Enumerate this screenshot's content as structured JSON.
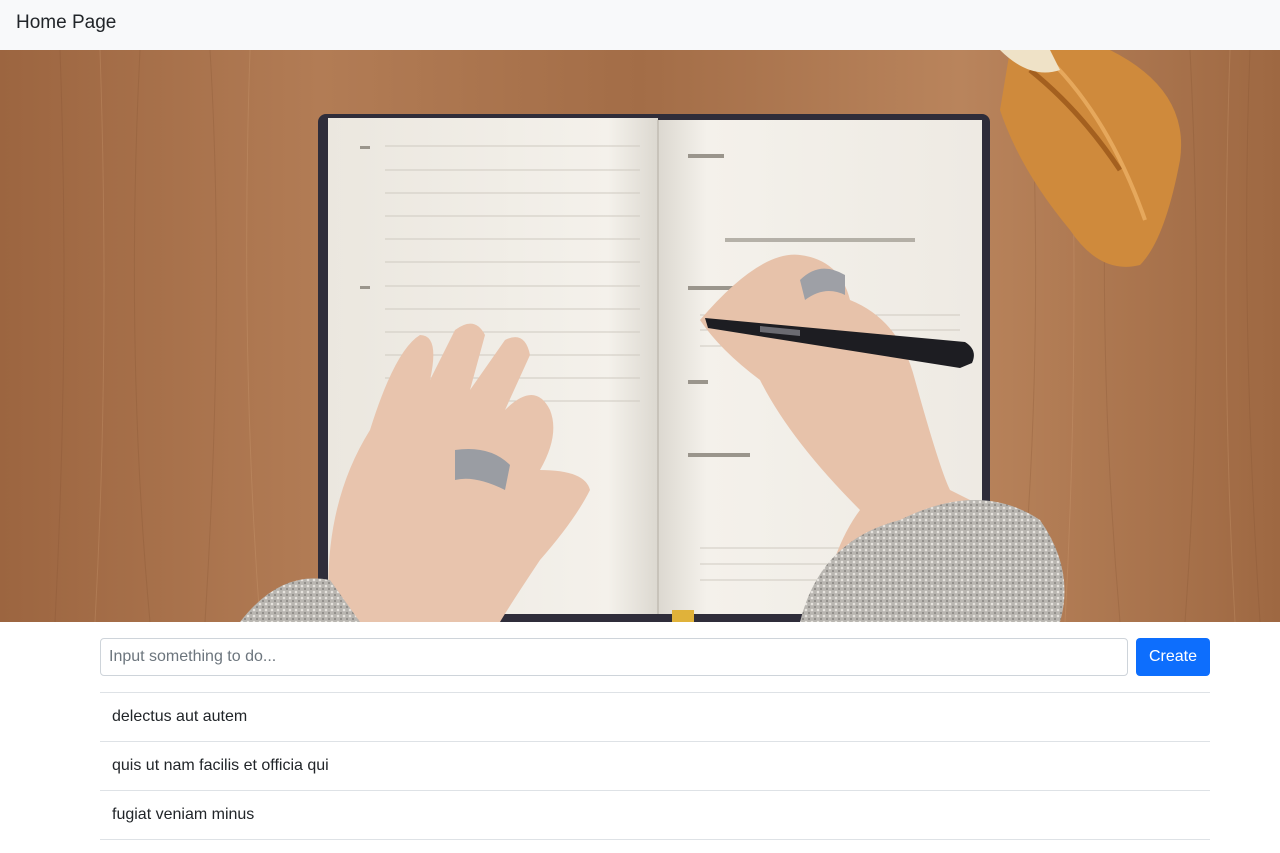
{
  "navbar": {
    "brand": "Home Page"
  },
  "hero": {
    "image": "notebook-writing-photo",
    "colors": {
      "wood": "#a8724a",
      "paper": "#f3f0ea",
      "cover": "#2f2d3a",
      "pastry": "#d08a3a"
    }
  },
  "form": {
    "placeholder": "Input something to do...",
    "value": "",
    "button_label": "Create"
  },
  "todos": [
    {
      "text": "delectus aut autem"
    },
    {
      "text": "quis ut nam facilis et officia qui"
    },
    {
      "text": "fugiat veniam minus"
    }
  ],
  "colors": {
    "primary": "#0d6efd",
    "navbar_bg": "#f8f9fa",
    "border": "#dee2e6"
  }
}
